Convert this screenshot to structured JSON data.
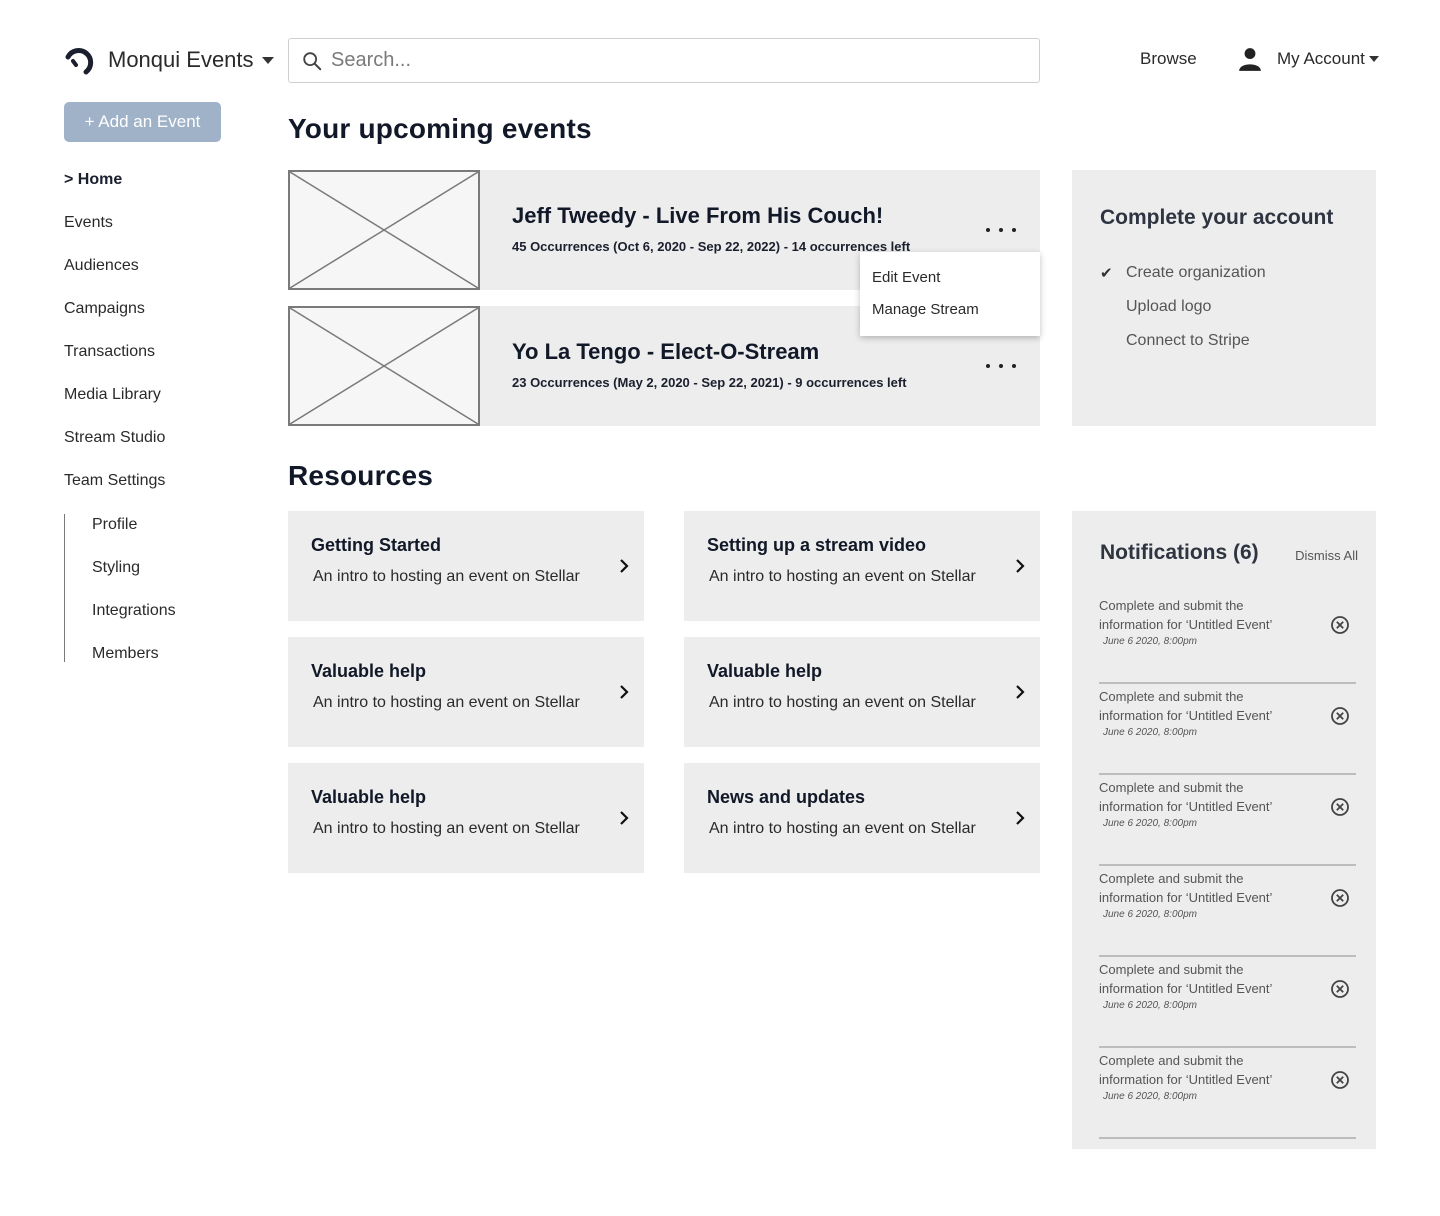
{
  "header": {
    "brand": "Monqui Events",
    "search_placeholder": "Search...",
    "browse": "Browse",
    "account": "My Account"
  },
  "sidebar": {
    "add_button": "+ Add an Event",
    "items": [
      {
        "label": "> Home",
        "active": true
      },
      {
        "label": "Events"
      },
      {
        "label": "Audiences"
      },
      {
        "label": "Campaigns"
      },
      {
        "label": "Transactions"
      },
      {
        "label": "Media Library"
      },
      {
        "label": "Stream Studio"
      },
      {
        "label": "Team Settings"
      }
    ],
    "sub_items": [
      {
        "label": "Profile"
      },
      {
        "label": "Styling"
      },
      {
        "label": "Integrations"
      },
      {
        "label": "Members"
      }
    ]
  },
  "upcoming": {
    "heading": "Your upcoming events",
    "events": [
      {
        "title": "Jeff Tweedy - Live From His Couch!",
        "meta": "45 Occurrences (Oct 6, 2020 - Sep 22, 2022) - 14 occurrences left"
      },
      {
        "title": "Yo La Tengo - Elect-O-Stream",
        "meta": "23 Occurrences (May 2, 2020 - Sep 22, 2021) - 9 occurrences left"
      }
    ],
    "menu": [
      "Edit Event",
      "Manage Stream"
    ]
  },
  "account_panel": {
    "title": "Complete your account",
    "items": [
      {
        "label": "Create organization",
        "mark": "✔"
      },
      {
        "label": "Upload logo",
        "mark": ""
      },
      {
        "label": "Connect to Stripe",
        "mark": ""
      }
    ]
  },
  "resources": {
    "heading": "Resources",
    "cards": [
      {
        "title": "Getting Started",
        "desc": "An intro to hosting an event on Stellar"
      },
      {
        "title": "Setting up a stream video",
        "desc": "An intro to hosting an event on Stellar"
      },
      {
        "title": "Valuable help",
        "desc": "An intro to hosting an event on Stellar"
      },
      {
        "title": "Valuable help",
        "desc": "An intro to hosting an event on Stellar"
      },
      {
        "title": "Valuable help",
        "desc": "An intro to hosting an event on Stellar"
      },
      {
        "title": "News and updates",
        "desc": "An intro to hosting an event on Stellar"
      }
    ]
  },
  "notifications": {
    "title": "Notifications (6)",
    "dismiss": "Dismiss All",
    "items": [
      {
        "text": "Complete and submit the information for ‘Untitled Event’",
        "time": "June 6 2020, 8:00pm"
      },
      {
        "text": "Complete and submit the information for ‘Untitled Event’",
        "time": "June 6 2020, 8:00pm"
      },
      {
        "text": "Complete and submit the information for ‘Untitled Event’",
        "time": "June 6 2020, 8:00pm"
      },
      {
        "text": "Complete and submit the information for ‘Untitled Event’",
        "time": "June 6 2020, 8:00pm"
      },
      {
        "text": "Complete and submit the information for ‘Untitled Event’",
        "time": "June 6 2020, 8:00pm"
      },
      {
        "text": "Complete and submit the information for ‘Untitled Event’",
        "time": "June 6 2020, 8:00pm"
      }
    ]
  },
  "colors": {
    "add_button_bg": "#9fb2c8",
    "card_bg": "#ededed",
    "heading": "#111827"
  }
}
